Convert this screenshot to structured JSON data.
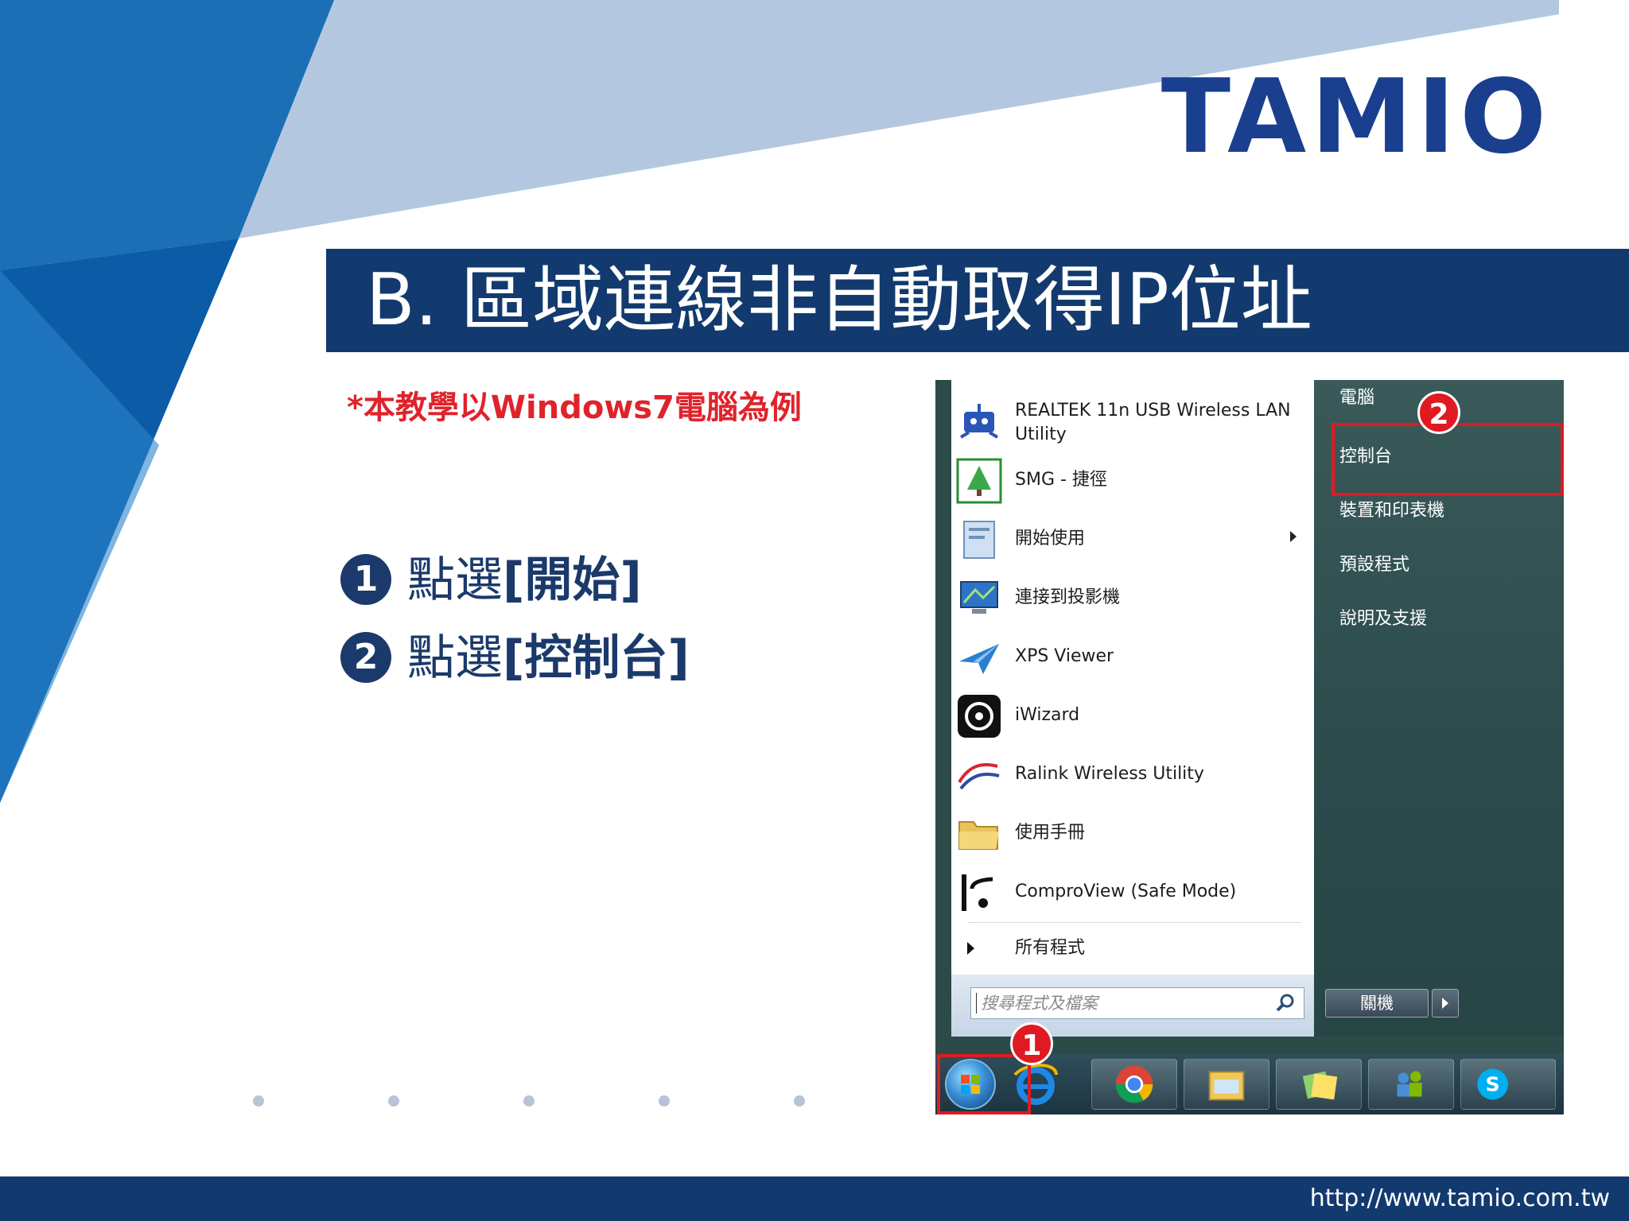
{
  "brand": {
    "logo_text": "TAMIO",
    "url": "http://www.tamio.com.tw"
  },
  "slide": {
    "title": "B. 區域連線非自動取得IP位址",
    "note": "*本教學以Windows7電腦為例",
    "steps": [
      {
        "num": "1",
        "prefix": "點選",
        "target": "[開始]"
      },
      {
        "num": "2",
        "prefix": "點選",
        "target": "[控制台]"
      }
    ]
  },
  "start_menu": {
    "programs": [
      {
        "label": "REALTEK 11n USB Wireless LAN Utility",
        "icon": "realtek-icon",
        "submenu": false
      },
      {
        "label": "SMG - 捷徑",
        "icon": "smg-icon",
        "submenu": false
      },
      {
        "label": "開始使用",
        "icon": "getting-started-icon",
        "submenu": true
      },
      {
        "label": "連接到投影機",
        "icon": "projector-icon",
        "submenu": false
      },
      {
        "label": "XPS Viewer",
        "icon": "xps-viewer-icon",
        "submenu": false
      },
      {
        "label": "iWizard",
        "icon": "iwizard-icon",
        "submenu": false
      },
      {
        "label": "Ralink Wireless Utility",
        "icon": "ralink-icon",
        "submenu": false
      },
      {
        "label": "使用手冊",
        "icon": "folder-icon",
        "submenu": false
      },
      {
        "label": "ComproView (Safe Mode)",
        "icon": "comproview-icon",
        "submenu": false
      }
    ],
    "all_programs": "所有程式",
    "search_placeholder": "搜尋程式及檔案",
    "right_items": [
      "電腦",
      "控制台",
      "裝置和印表機",
      "預設程式",
      "說明及支援"
    ],
    "shutdown_label": "關機"
  },
  "callouts": {
    "badge1": "1",
    "badge2": "2"
  },
  "colors": {
    "navy": "#123a6e",
    "red": "#e01a22",
    "accent_blue": "#1a3f8f"
  }
}
